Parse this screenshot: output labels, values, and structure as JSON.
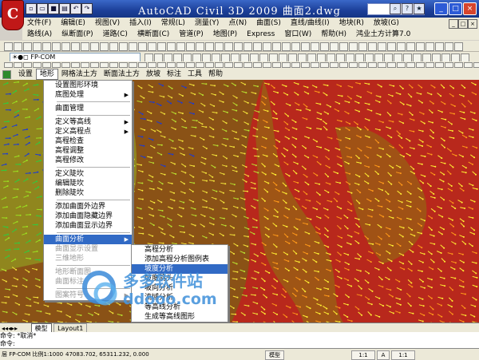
{
  "title_bar": {
    "title": "AutoCAD Civil 3D 2009  曲面2.dwg",
    "app_logo": "C",
    "min_label": "_",
    "max_label": "□",
    "close_label": "×",
    "mdi_min": "_",
    "mdi_max": "□",
    "mdi_close": "×"
  },
  "menus": {
    "row1": [
      "文件(F)",
      "编辑(E)",
      "视图(V)",
      "插入(I)",
      "常规(L)",
      "测量(Y)",
      "点(N)",
      "曲面(S)",
      "直线/曲线(I)",
      "地块(R)",
      "放坡(G)"
    ],
    "row2": [
      "路线(A)",
      "纵断面(P)",
      "道路(C)",
      "横断面(C)",
      "管道(P)",
      "地图(P)",
      "Express",
      "窗口(W)",
      "帮助(H)",
      "鸿业土方计算7.0"
    ]
  },
  "toolbar": {
    "layer_name": "FP-COM",
    "style_value": "Standard"
  },
  "civil_menu": {
    "items": [
      "设置",
      "地形",
      "网格法土方",
      "断面法土方",
      "放坡",
      "标注",
      "工具",
      "帮助"
    ],
    "active_index": 1
  },
  "terrain_menu": {
    "items": [
      {
        "label": "设置图形环境",
        "arrow": false,
        "disabled": false
      },
      {
        "label": "底图处理",
        "arrow": true,
        "disabled": false
      },
      {
        "sep": true
      },
      {
        "label": "曲面管理",
        "arrow": false,
        "disabled": false
      },
      {
        "sep": true
      },
      {
        "label": "定义等高线",
        "arrow": true,
        "disabled": false
      },
      {
        "label": "定义高程点",
        "arrow": true,
        "disabled": false
      },
      {
        "label": "高程检查",
        "arrow": false,
        "disabled": false
      },
      {
        "label": "高程调整",
        "arrow": false,
        "disabled": false
      },
      {
        "label": "高程修改",
        "arrow": false,
        "disabled": false
      },
      {
        "sep": true
      },
      {
        "label": "定义陡坎",
        "arrow": false,
        "disabled": false
      },
      {
        "label": "编辑陡坎",
        "arrow": false,
        "disabled": false
      },
      {
        "label": "删除陡坎",
        "arrow": false,
        "disabled": false
      },
      {
        "sep": true
      },
      {
        "label": "添加曲面外边界",
        "arrow": false,
        "disabled": false
      },
      {
        "label": "添加曲面隐藏边界",
        "arrow": false,
        "disabled": false
      },
      {
        "label": "添加曲面显示边界",
        "arrow": false,
        "disabled": false
      },
      {
        "sep": true
      },
      {
        "label": "曲面分析",
        "arrow": true,
        "disabled": false,
        "selected": true
      },
      {
        "label": "曲面显示设置",
        "arrow": false,
        "disabled": true
      },
      {
        "label": "三维地形",
        "arrow": false,
        "disabled": true
      },
      {
        "sep": true
      },
      {
        "label": "地形断面图",
        "arrow": false,
        "disabled": true
      },
      {
        "label": "曲面标注",
        "arrow": false,
        "disabled": true
      },
      {
        "sep": true
      },
      {
        "label": "图案符号",
        "arrow": true,
        "disabled": true
      }
    ]
  },
  "analysis_submenu": {
    "items": [
      {
        "label": "高程分析",
        "selected": false
      },
      {
        "label": "添加高程分析图例表",
        "selected": false
      },
      {
        "label": "坡度分析",
        "selected": true
      },
      {
        "label": "坡度箭头",
        "selected": false
      },
      {
        "label": "坡向分析",
        "selected": false
      },
      {
        "label": "流域分析",
        "selected": false
      },
      {
        "label": "等高线分析",
        "selected": false
      },
      {
        "label": "生成等高线图形",
        "selected": false
      }
    ]
  },
  "watermark": {
    "text": "多多软件站",
    "url": "ddooo.com"
  },
  "layout_tabs": [
    "模型",
    "Layout1"
  ],
  "command_lines": [
    "命令: *取消*",
    "命令:"
  ],
  "status_bar": {
    "layer": "层 FP-COM 比例1:1000",
    "coords": "47083.702, 65311.232, 0.000",
    "buttons": [
      "模型",
      "1:1",
      "A",
      "1:1"
    ]
  },
  "colors": {
    "title_blue": "#1c3f99",
    "menu_select": "#316ac5",
    "terrain_red": "#b8281c",
    "terrain_brown": "#8a5216",
    "terrain_olive": "#90861e"
  }
}
